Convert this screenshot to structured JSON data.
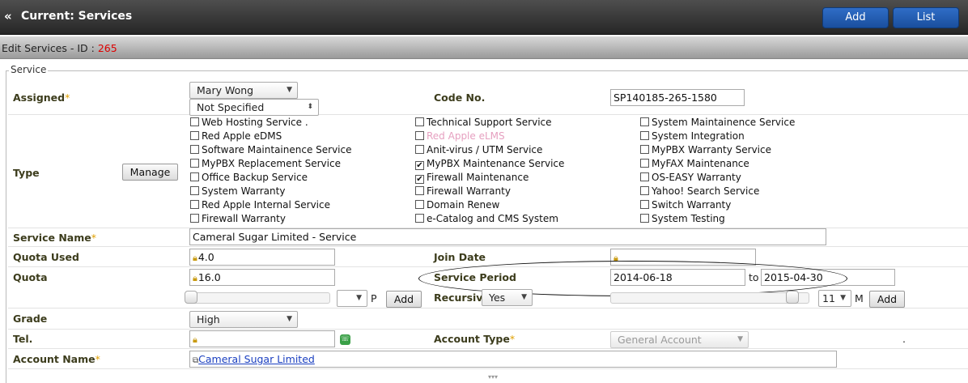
{
  "header": {
    "title": "Current: Services",
    "add_label": "Add",
    "list_label": "List"
  },
  "subheader": {
    "label": "Edit Services - ID : ",
    "id": "265"
  },
  "section": {
    "legend": "Service"
  },
  "assigned": {
    "label": "Assigned",
    "person": "Mary Wong",
    "status": "Not Specified"
  },
  "code": {
    "label": "Code No.",
    "value": "SP140185-265-1580"
  },
  "type": {
    "label": "Type",
    "manage_label": "Manage",
    "col1": [
      {
        "label": "Web Hosting Service .",
        "checked": false
      },
      {
        "label": "Red Apple eDMS",
        "checked": false
      },
      {
        "label": "Software Maintainence Service",
        "checked": false
      },
      {
        "label": "MyPBX Replacement Service",
        "checked": false
      },
      {
        "label": "Office Backup Service",
        "checked": false
      },
      {
        "label": "System Warranty",
        "checked": false
      },
      {
        "label": "Red Apple Internal Service",
        "checked": false
      },
      {
        "label": "Firewall Warranty",
        "checked": false
      }
    ],
    "col2": [
      {
        "label": "Technical Support Service",
        "checked": false
      },
      {
        "label": "Red Apple eLMS",
        "checked": false,
        "disabled": true
      },
      {
        "label": "Anit-virus / UTM Service",
        "checked": false
      },
      {
        "label": "MyPBX Maintenance Service",
        "checked": true
      },
      {
        "label": "Firewall Maintenance",
        "checked": true
      },
      {
        "label": "Firewall Warranty",
        "checked": false
      },
      {
        "label": "Domain Renew",
        "checked": false
      },
      {
        "label": "e-Catalog and CMS System",
        "checked": false
      }
    ],
    "col3": [
      {
        "label": "System Maintainence Service",
        "checked": false
      },
      {
        "label": "System Integration",
        "checked": false
      },
      {
        "label": "MyPBX Warranty Service",
        "checked": false
      },
      {
        "label": "MyFAX Maintenance",
        "checked": false
      },
      {
        "label": "OS-EASY Warranty",
        "checked": false
      },
      {
        "label": "Yahoo! Search Service",
        "checked": false
      },
      {
        "label": "Switch Warranty",
        "checked": false
      },
      {
        "label": "System Testing",
        "checked": false
      }
    ]
  },
  "service_name": {
    "label": "Service Name",
    "value": "Cameral Sugar Limited - Service"
  },
  "quota_used": {
    "label": "Quota Used",
    "value": "4.0"
  },
  "join_date": {
    "label": "Join Date",
    "value": ""
  },
  "quota": {
    "label": "Quota",
    "value": "16.0",
    "unit": "P",
    "add_label": "Add"
  },
  "service_period": {
    "label": "Service Period",
    "from": "2014-06-18",
    "sep": "to",
    "to": "2015-04-30"
  },
  "recursive": {
    "label": "Recursive",
    "value": "Yes",
    "months": "11",
    "unit": "M",
    "add_label": "Add"
  },
  "grade": {
    "label": "Grade",
    "value": "High"
  },
  "tel": {
    "label": "Tel.",
    "value": ""
  },
  "account_type": {
    "label": "Account Type",
    "value": "General Account",
    "dot": "."
  },
  "account_name": {
    "label": "Account Name",
    "value": "Cameral Sugar Limited"
  },
  "footer": {
    "more": "▾▾▾"
  }
}
